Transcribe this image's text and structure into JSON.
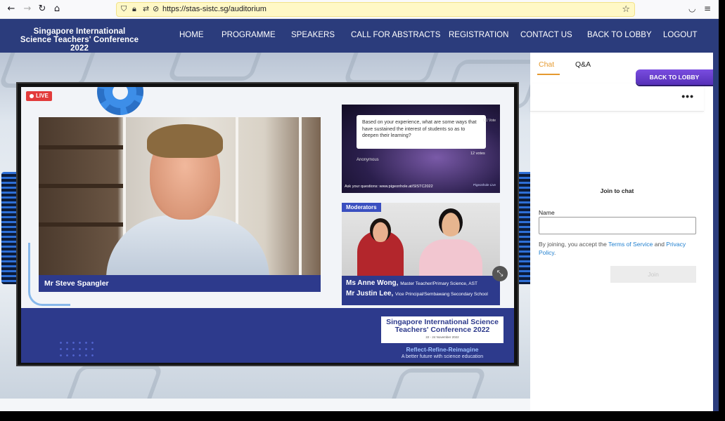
{
  "browser": {
    "back": "←",
    "forward": "→",
    "reload": "↻",
    "home": "⌂",
    "url": "https://stas-sistc.sg/auditorium",
    "icons": [
      "shield-icon",
      "lock-icon",
      "permissions-icon",
      "camera-blocked-icon",
      "star-icon",
      "pocket-icon",
      "menu-icon"
    ]
  },
  "site": {
    "logo": "Singapore International Science Teachers' Conference 2022",
    "nav": [
      "HOME",
      "PROGRAMME",
      "SPEAKERS",
      "CALL FOR ABSTRACTS",
      "REGISTRATION",
      "CONTACT US",
      "BACK TO LOBBY",
      "LOGOUT"
    ]
  },
  "stream": {
    "live": "LIVE",
    "speaker_name": "Mr Steve Spangler",
    "poll": {
      "question": "Based on your experience, what are some ways that have sustained the interest of students so as to deepen their learning?",
      "author": "Anonymous",
      "votes": "12 votes",
      "link": "Ask your questions: www.pigeonhole.at/SISTC2022",
      "side": "Q1 Vote",
      "logo": "Pigeonhole Live"
    },
    "moderators_tag": "Moderators",
    "moderators": [
      {
        "name": "Ms Anne Wong,",
        "role": "Master Teacher/Primary Science, AST"
      },
      {
        "name": "Mr Justin Lee,",
        "role": "Vice Principal/Sembawang Secondary School"
      }
    ],
    "conference": {
      "title": "Singapore International Science Teachers' Conference 2022",
      "dates": "22 - 24 November 2022",
      "tagline": "Reflect-Refine-Reimagine",
      "subtitle": "A better future with science education"
    }
  },
  "panel": {
    "tabs": [
      "Chat",
      "Q&A"
    ],
    "active_tab": "Chat",
    "back_to_lobby": "BACK TO LOBBY",
    "more": "•••",
    "join_title": "Join to chat",
    "name_label": "Name",
    "name_value": "",
    "terms_prefix": "By joining, you accept the ",
    "terms_link": "Terms of Service",
    "terms_mid": " and ",
    "privacy_link": "Privacy Policy",
    "terms_suffix": ".",
    "join_button": "Join"
  },
  "colors": {
    "nav_bg": "#2b3c7c",
    "accent_tab": "#e59a2f",
    "link": "#1f7fcf",
    "url_highlight": "#fff8c6",
    "lobby_button": "#6a3fd0",
    "live": "#e23b3b"
  }
}
